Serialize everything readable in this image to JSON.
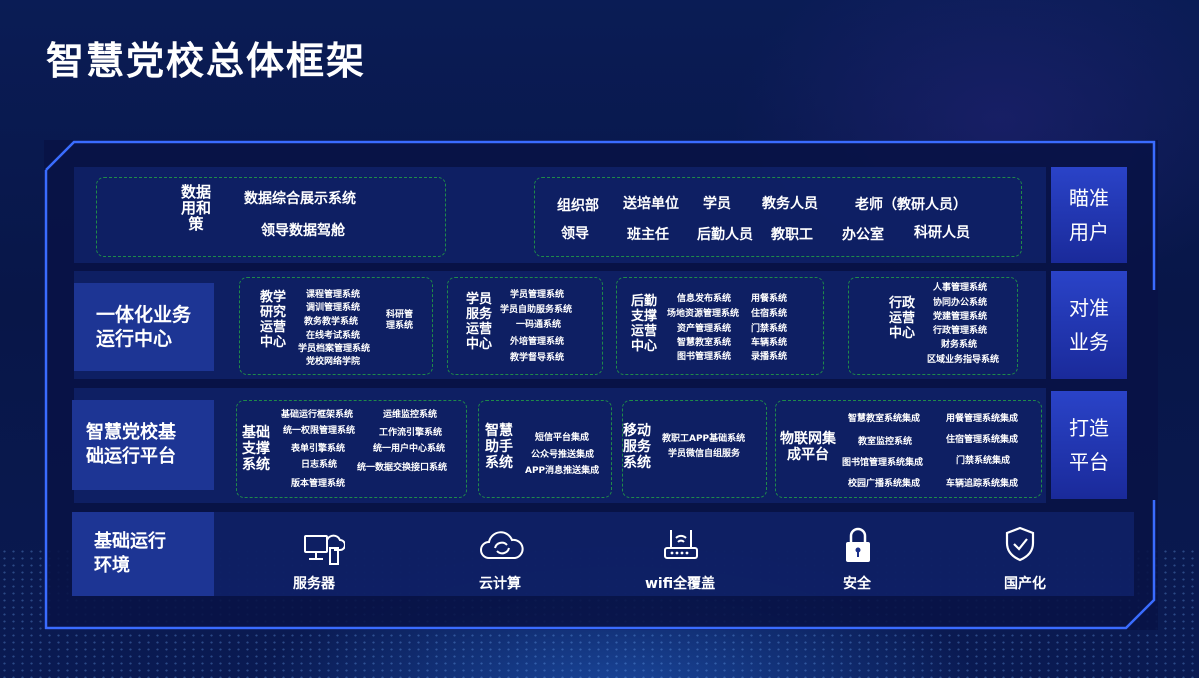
{
  "title": "智慧党校总体框架",
  "side_labels": [
    "瞄准\n用户",
    "对准\n业务",
    "打造\n平台"
  ],
  "row1": {
    "block1": {
      "title": "数据\n用和\n策",
      "items": [
        "数据综合展示系统",
        "领导数据驾舱"
      ]
    },
    "users": [
      "组织部",
      "送培单位",
      "学员",
      "教务人员",
      "老师（教研人员）",
      "领导",
      "班主任",
      "后勤人员",
      "教职工",
      "办公室",
      "科研人员"
    ]
  },
  "row2": {
    "label": "一体化业务\n运行中心",
    "teaching": {
      "title": "教学\n研究\n运营\n中心",
      "items": [
        "课程管理系统",
        "调训管理系统",
        "教务教学系统",
        "在线考试系统",
        "学员档案管理系统",
        "党校网络学院"
      ],
      "extra": "科研管\n理系统"
    },
    "student": {
      "title": "学员\n服务\n运营\n中心",
      "items": [
        "学员管理系统",
        "学员自助服务系统",
        "一码通系统",
        "外培管理系统",
        "教学督导系统"
      ]
    },
    "logistics": {
      "title": "后勤\n支撑\n运营\n中心",
      "items_left": [
        "信息发布系统",
        "场地资源管理系统",
        "资产管理系统",
        "智慧教室系统",
        "图书管理系统"
      ],
      "items_right": [
        "用餐系统",
        "住宿系统",
        "门禁系统",
        "车辆系统",
        "录播系统"
      ]
    },
    "admin": {
      "title": "行政\n运营\n中心",
      "items": [
        "人事管理系统",
        "协同办公系统",
        "党建管理系统",
        "行政管理系统",
        "财务系统",
        "区域业务指导系统"
      ]
    }
  },
  "row3": {
    "label": "智慧党校基\n础运行平台",
    "support": {
      "title": "基础\n支撑\n系统",
      "items_left": [
        "基础运行框架系统",
        "统一权限管理系统",
        "表单引擎系统",
        "日志系统",
        "版本管理系统"
      ],
      "items_right": [
        "运维监控系统",
        "工作流引擎系统",
        "统一用户中心系统",
        "统一数据交换接口系统"
      ]
    },
    "assistant": {
      "title": "智慧\n助手\n系统",
      "items": [
        "短信平台集成",
        "公众号推送集成",
        "APP消息推送集成"
      ]
    },
    "mobile": {
      "title": "移动\n服务\n系统",
      "items": [
        "教职工APP基础系统",
        "学员微信自组服务"
      ]
    },
    "iot": {
      "title": "物联网集\n成平台",
      "items_left": [
        "智慧教室系统集成",
        "教室监控系统",
        "图书馆管理系统集成",
        "校园广播系统集成"
      ],
      "items_right": [
        "用餐管理系统集成",
        "住宿管理系统集成",
        "门禁系统集成",
        "车辆追踪系统集成"
      ]
    }
  },
  "row4": {
    "label": "基础运行\n环境",
    "items": [
      {
        "icon": "server-icon",
        "label": "服务器"
      },
      {
        "icon": "cloud-icon",
        "label": "云计算"
      },
      {
        "icon": "router-icon",
        "label": "wifi全覆盖"
      },
      {
        "icon": "lock-icon",
        "label": "安全"
      },
      {
        "icon": "shield-icon",
        "label": "国产化"
      }
    ]
  }
}
